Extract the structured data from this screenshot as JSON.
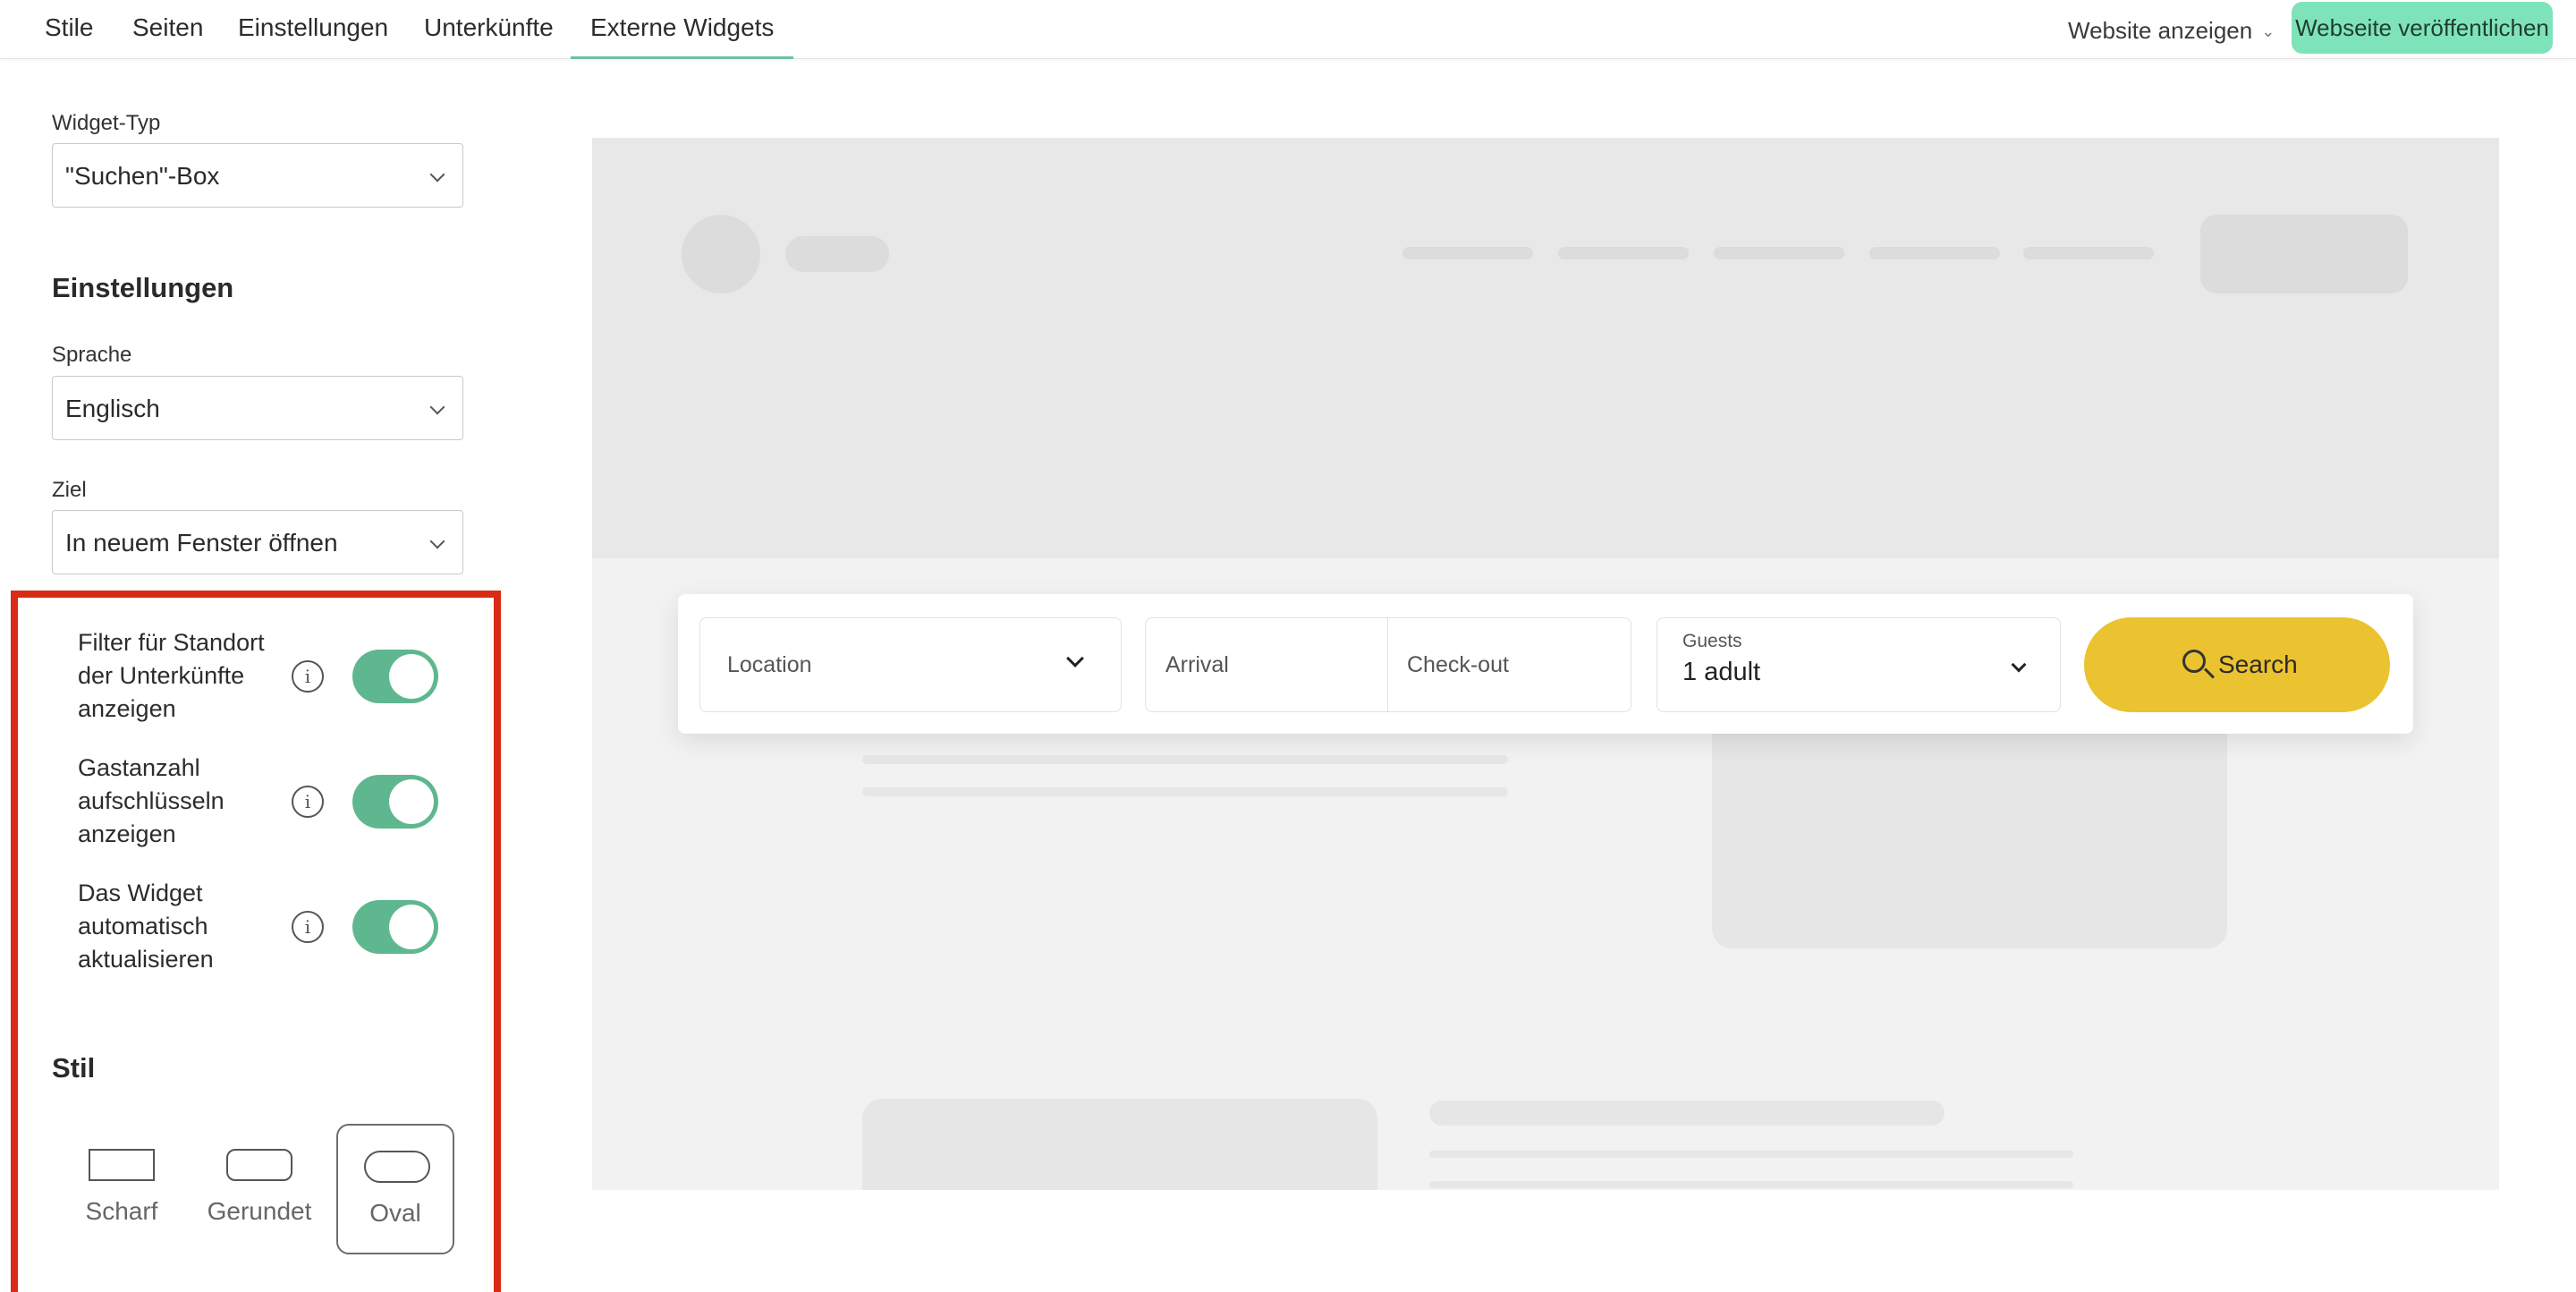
{
  "nav": {
    "tabs": [
      "Stile",
      "Seiten",
      "Einstellungen",
      "Unterkünfte",
      "Externe Widgets"
    ],
    "active_tab": "Externe Widgets",
    "view_site": "Website anzeigen",
    "publish": "Webseite veröffentlichen"
  },
  "panel": {
    "widget_type": {
      "label": "Widget-Typ",
      "value": "\"Suchen\"-Box"
    },
    "settings_title": "Einstellungen",
    "language": {
      "label": "Sprache",
      "value": "Englisch"
    },
    "target": {
      "label": "Ziel",
      "value": "In neuem Fenster öffnen"
    },
    "toggles": [
      {
        "label": "Filter für Standort der Unterkünfte anzeigen",
        "on": true
      },
      {
        "label": "Gastanzahl aufschlüsseln anzeigen",
        "on": true
      },
      {
        "label": "Das Widget automatisch aktualisieren",
        "on": true
      }
    ],
    "style_title": "Stil",
    "styles": [
      "Scharf",
      "Gerundet",
      "Oval"
    ],
    "selected_style": "Oval"
  },
  "preview": {
    "location": "Location",
    "arrival": "Arrival",
    "checkout": "Check-out",
    "guests_label": "Guests",
    "guests_value": "1 adult",
    "search": "Search"
  },
  "colors": {
    "accent_green": "#5fb78f",
    "publish_bg": "#7fe3b9",
    "search_button": "#ebc22f",
    "highlight_border": "#d92b15"
  }
}
